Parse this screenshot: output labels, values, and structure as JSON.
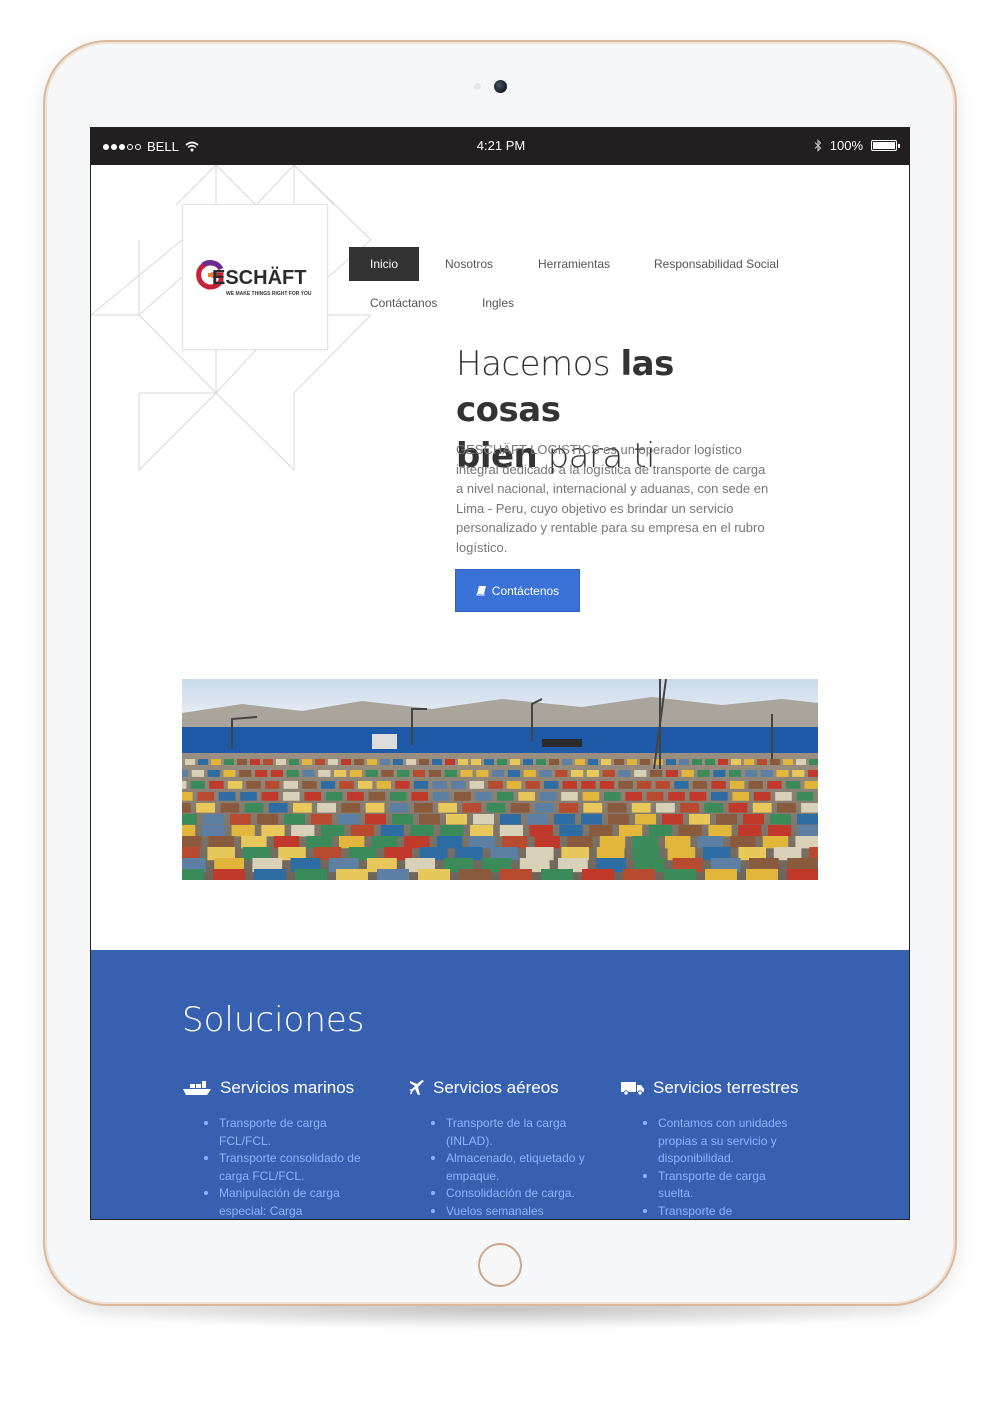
{
  "status_bar": {
    "carrier": "BELL",
    "time": "4:21 PM",
    "battery": "100%"
  },
  "site": {
    "logo_text": "ESCHÄFT",
    "logo_tagline": "WE MAKE THINGS RIGHT FOR YOU",
    "nav": [
      {
        "label": "Inicio",
        "active": true
      },
      {
        "label": "Nosotros"
      },
      {
        "label": "Herramientas"
      },
      {
        "label": "Responsabilidad Social"
      },
      {
        "label": "Contáctanos"
      },
      {
        "label": "Ingles"
      }
    ],
    "hero": {
      "title_part1": "Hacemos ",
      "title_bold1": "las cosas",
      "title_bold2": "bien",
      "title_part2": " para ti",
      "text": "GESCHÄFT LOGISTICS es un operador logístico integral dedicado a la logística de transporte de carga a nivel nacional, internacional y aduanas, con sede en Lima - Peru, cuyo objetivo es brindar un servicio personalizado y rentable para su empresa en el rubro logístico.",
      "cta_label": "Contáctenos"
    },
    "solutions": {
      "title": "Soluciones",
      "columns": [
        {
          "heading": "Servicios marinos",
          "icon": "ship-icon",
          "items": [
            "Transporte de carga FCL/FCL.",
            "Transporte consolidado de carga FCL/FCL.",
            "Manipulación de carga especial: Carga"
          ]
        },
        {
          "heading": "Servicios aéreos",
          "icon": "plane-icon",
          "items": [
            "Transporte de la carga (INLAD).",
            "Almacenado, etiquetado y empaque.",
            "Consolidación de carga.",
            "Vuelos semanales"
          ]
        },
        {
          "heading": "Servicios terrestres",
          "icon": "truck-icon",
          "items": [
            "Contamos con unidades propias a su servicio y disponibilidad.",
            "Transporte de carga suelta.",
            "Transporte de"
          ]
        }
      ]
    }
  },
  "colors": {
    "brand_blue": "#3760b0",
    "button_blue": "#3a72d8",
    "nav_active": "#333333",
    "status_bar": "#231f20",
    "frame_gold": "#d9b89c"
  }
}
